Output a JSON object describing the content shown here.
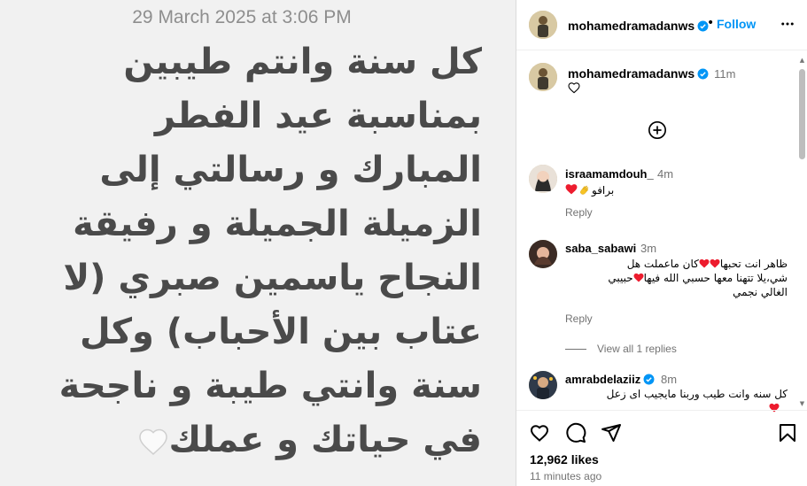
{
  "post": {
    "date": "29 March 2025 at 3:06 PM",
    "text": "كل سنة وانتم طيبين بمناسبة عيد الفطر المبارك و رسالتي إلى الزميلة الجميلة و رفيقة النجاح ياسمين صبري (لا عتاب بين الأحباب) وكل سنة وانتي طيبة و ناجحة في حياتك و عملك"
  },
  "header": {
    "username": "mohamedramadanws",
    "separator": "•",
    "follow_label": "Follow"
  },
  "caption": {
    "username": "mohamedramadanws",
    "time": "11m"
  },
  "comments": [
    {
      "username": "israamamdouh_",
      "time": "4m",
      "text": "برافو",
      "reply": "Reply"
    },
    {
      "username": "saba_sabawi",
      "time": "3m",
      "line1": "ظاهر انت تحبها",
      "line1b": "كان ماعملت هل",
      "line2": "شي،يلا تتهنا معها حسبي الله فيها",
      "line2b": "حبيبي",
      "line3": "الغالي نجمي",
      "reply": "Reply",
      "view_all": "View all 1 replies"
    },
    {
      "username": "amrabdelaziiz",
      "time": "8m",
      "text": "كل سنه وانت طيب وربنا مايجيب اى زعل"
    }
  ],
  "footer": {
    "likes": "12,962 likes",
    "ago": "11 minutes ago"
  },
  "colors": {
    "accent": "#0095f6",
    "heart_red": "#ed1c2e",
    "verified": "#0095f6"
  }
}
